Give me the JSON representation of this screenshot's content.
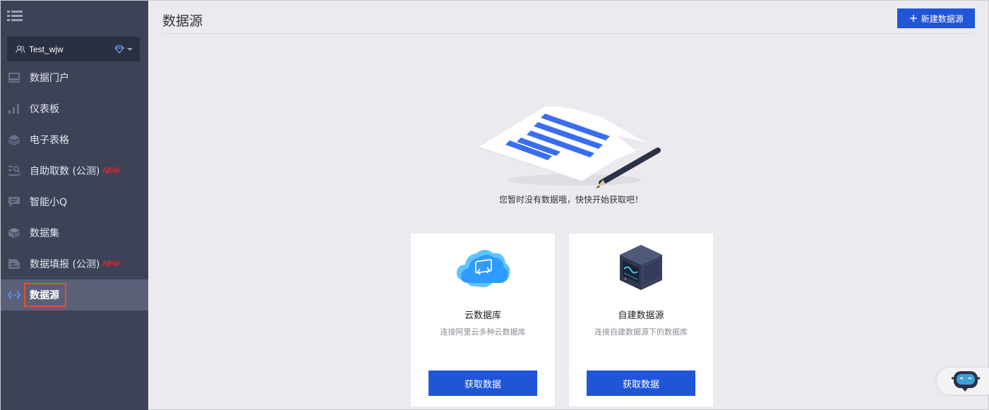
{
  "sidebar": {
    "menu_icon": "list-icon",
    "workspace": {
      "name": "Test_wjw",
      "icon": "users-icon",
      "badge_icon": "diamond-icon"
    },
    "items": [
      {
        "label": "数据门户",
        "icon": "portal-icon"
      },
      {
        "label": "仪表板",
        "icon": "bar-chart-icon"
      },
      {
        "label": "电子表格",
        "icon": "layers-icon"
      },
      {
        "label": "自助取数 (公测)",
        "icon": "self-query-icon",
        "badge": "NEW"
      },
      {
        "label": "智能小Q",
        "icon": "chat-icon"
      },
      {
        "label": "数据集",
        "icon": "cube-icon"
      },
      {
        "label": "数据填报 (公测)",
        "icon": "form-icon",
        "badge": "NEW"
      },
      {
        "label": "数据源",
        "icon": "datasource-icon",
        "active": true
      }
    ]
  },
  "header": {
    "title": "数据源",
    "new_button": "新建数据源"
  },
  "empty_state": {
    "message": "您暂时没有数据哦，快快开始获取吧！",
    "illustration": "document-pencil-icon"
  },
  "cards": [
    {
      "title": "云数据库",
      "description": "连接阿里云多种云数据库",
      "button": "获取数据",
      "icon": "cloud-database-icon"
    },
    {
      "title": "自建数据源",
      "description": "连接自建数据源下的数据库",
      "button": "获取数据",
      "icon": "server-icon"
    }
  ],
  "colors": {
    "sidebar": "#3d4357",
    "accent": "#2155d8",
    "active_item": "#5a6078",
    "highlight_frame": "#e2502f"
  }
}
